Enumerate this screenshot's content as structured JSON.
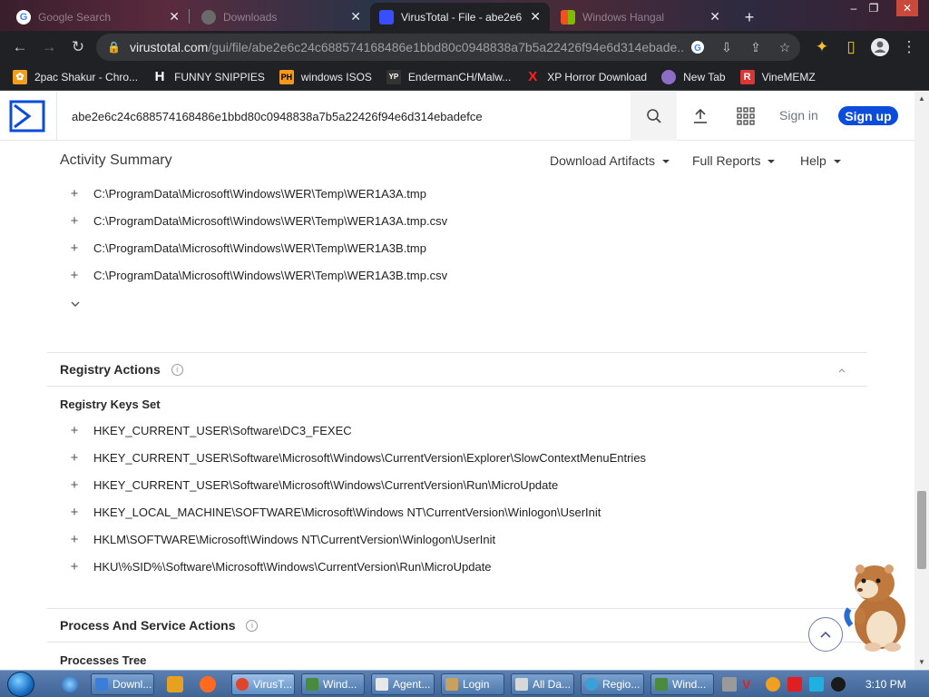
{
  "browser": {
    "tabs": [
      {
        "title": "Google Search",
        "active": false
      },
      {
        "title": "Downloads",
        "active": false
      },
      {
        "title": "VirusTotal - File - abe2e6",
        "active": true
      },
      {
        "title": "Windows Hangal",
        "active": false
      }
    ],
    "new_tab_symbol": "+",
    "url_host": "virustotal.com",
    "url_path": "/gui/file/abe2e6c24c688574168486e1bbd80c0948838a7b5a22426f94e6d314ebade..."
  },
  "bookmarks": [
    {
      "label": "2pac Shakur - Chro...",
      "icon": "tupac-icon",
      "color": "#f29d1c"
    },
    {
      "label": "FUNNY SNIPPIES",
      "icon": "h-icon",
      "color": "#ffffff"
    },
    {
      "label": "windows ISOS",
      "icon": "ph-icon",
      "color": "#f7971e"
    },
    {
      "label": "EndermanCH/Malw...",
      "icon": "yp-icon",
      "color": "#333333"
    },
    {
      "label": "XP Horror Download",
      "icon": "x-icon",
      "color": "#ff2020"
    },
    {
      "label": "New Tab",
      "icon": "globe-icon",
      "color": "#8c6dc8"
    },
    {
      "label": "VineMEMZ",
      "icon": "r-icon",
      "color": "#d93636"
    }
  ],
  "vt": {
    "search_value": "abe2e6c24c688574168486e1bbd80c0948838a7b5a22426f94e6d314ebadefce",
    "sign_in": "Sign in",
    "sign_up": "Sign up",
    "section_title": "Activity Summary",
    "menus": [
      "Download Artifacts",
      "Full Reports",
      "Help"
    ],
    "brand_color": "#0b4dda"
  },
  "files_written": [
    "C:\\ProgramData\\Microsoft\\Windows\\WER\\Temp\\WER1A3A.tmp",
    "C:\\ProgramData\\Microsoft\\Windows\\WER\\Temp\\WER1A3A.tmp.csv",
    "C:\\ProgramData\\Microsoft\\Windows\\WER\\Temp\\WER1A3B.tmp",
    "C:\\ProgramData\\Microsoft\\Windows\\WER\\Temp\\WER1A3B.tmp.csv"
  ],
  "registry": {
    "title": "Registry Actions",
    "subtitle": "Registry Keys Set",
    "keys": [
      "HKEY_CURRENT_USER\\Software\\DC3_FEXEC",
      "HKEY_CURRENT_USER\\Software\\Microsoft\\Windows\\CurrentVersion\\Explorer\\SlowContextMenuEntries",
      "HKEY_CURRENT_USER\\Software\\Microsoft\\Windows\\CurrentVersion\\Run\\MicroUpdate",
      "HKEY_LOCAL_MACHINE\\SOFTWARE\\Microsoft\\Windows NT\\CurrentVersion\\Winlogon\\UserInit",
      "HKLM\\SOFTWARE\\Microsoft\\Windows NT\\CurrentVersion\\Winlogon\\UserInit",
      "HKU\\%SID%\\Software\\Microsoft\\Windows\\CurrentVersion\\Run\\MicroUpdate"
    ]
  },
  "process": {
    "title": "Process And Service Actions",
    "subtitle": "Processes Tree"
  },
  "taskbar": {
    "tasks": [
      {
        "label": "Downl...",
        "color": "#3b7dd8"
      },
      {
        "label": "VirusT...",
        "color": "#e0452b",
        "active": true
      },
      {
        "label": "Wind...",
        "color": "#4a8a3c"
      },
      {
        "label": "Agent...",
        "color": "#e8e8e8"
      },
      {
        "label": "Login",
        "color": "#c8a060"
      },
      {
        "label": "All Da...",
        "color": "#d8d8d8"
      },
      {
        "label": "Regio...",
        "color": "#3aa0d8"
      },
      {
        "label": "Wind...",
        "color": "#4a8a3c"
      }
    ],
    "clock": "3:10 PM"
  }
}
